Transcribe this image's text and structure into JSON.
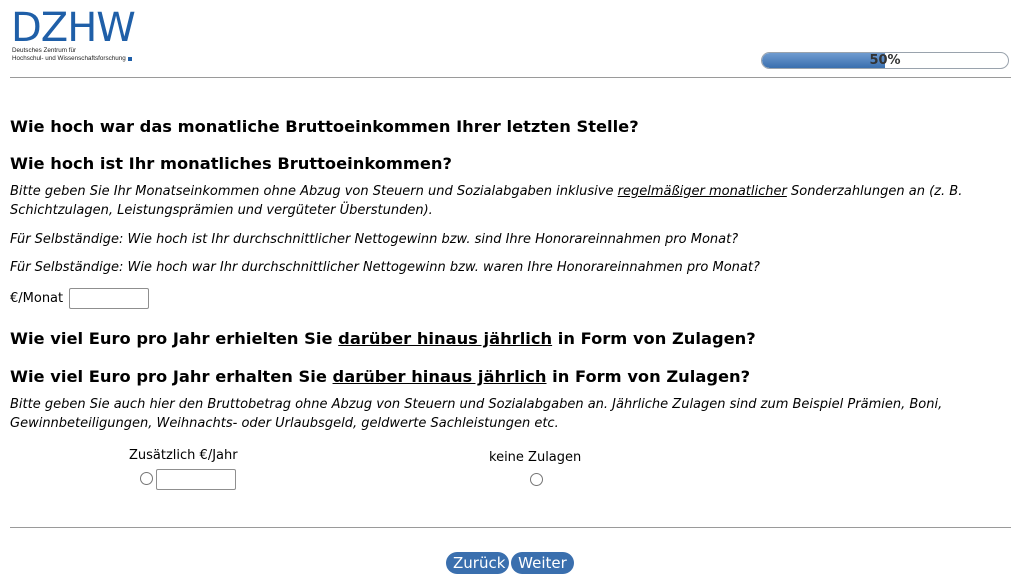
{
  "logo": {
    "wordmark": "DZHW",
    "subline1": "Deutsches Zentrum für",
    "subline2": "Hochschul- und Wissenschaftsforschung"
  },
  "progress": {
    "percent": 50,
    "label": "50%"
  },
  "questions": {
    "q1_past": "Wie hoch war das monatliche Bruttoeinkommen Ihrer letzten Stelle?",
    "q1_current": "Wie hoch ist Ihr monatliches Bruttoeinkommen?",
    "q1_hint_part1": "Bitte geben Sie Ihr Monatseinkommen ohne Abzug von Steuern und Sozialabgaben inklusive ",
    "q1_hint_underlined": "regelmäßiger monatlicher",
    "q1_hint_part2": " Sonderzahlungen an (z. B. Schichtzulagen, Leistungsprämien und vergüteter Überstunden).",
    "q1_self_current": "Für Selbständige: Wie hoch ist Ihr durchschnittlicher Nettogewinn bzw. sind Ihre Honorareinnahmen pro Monat?",
    "q1_self_past": "Für Selbständige: Wie hoch war Ihr durchschnittlicher Nettogewinn bzw. waren Ihre Honorareinnahmen pro Monat?",
    "q1_unit_label": "€/Monat",
    "q1_value": "",
    "q2_past_part1": "Wie viel Euro pro Jahr erhielten Sie ",
    "q2_past_underlined": "darüber hinaus jährlich",
    "q2_past_part2": " in Form von Zulagen?",
    "q2_current_part1": "Wie viel Euro pro Jahr erhalten Sie ",
    "q2_current_underlined": "darüber hinaus jährlich",
    "q2_current_part2": " in Form von Zulagen?",
    "q2_hint": "Bitte geben Sie auch hier den Bruttobetrag ohne Abzug von Steuern und Sozialabgaben an. Jährliche Zulagen sind zum Beispiel Prämien, Boni, Gewinnbeteiligungen, Weihnachts- oder Urlaubsgeld, geldwerte Sachleistungen etc.",
    "q2_option_amount_label": "Zusätzlich €/Jahr",
    "q2_option_amount_value": "",
    "q2_option_none_label": "keine Zulagen"
  },
  "nav": {
    "back_label": "Zurück",
    "next_label": "Weiter"
  },
  "colors": {
    "brand": "#1f5fa8",
    "button": "#3a6fae"
  }
}
